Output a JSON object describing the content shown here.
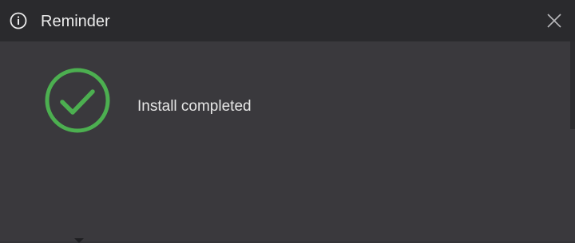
{
  "dialog": {
    "title": "Reminder",
    "message": "Install completed"
  },
  "icons": {
    "title_icon": "info-icon",
    "close_icon": "close-icon",
    "status_icon": "check-circle-icon"
  },
  "colors": {
    "titlebar_bg": "#2a2a2d",
    "body_bg": "#3a393d",
    "success": "#4caf50",
    "text": "#ececec"
  }
}
